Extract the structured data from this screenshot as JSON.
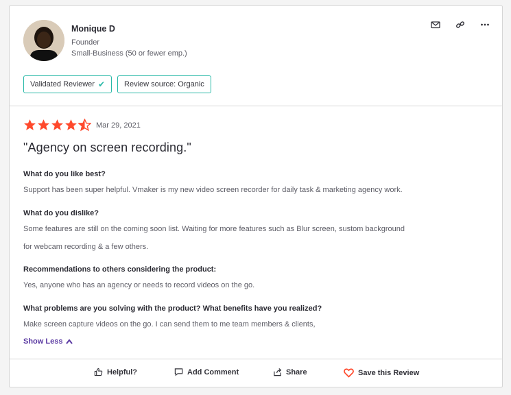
{
  "reviewer": {
    "name": "Monique D",
    "title": "Founder",
    "segment": "Small-Business (50 or fewer emp.)",
    "badges": [
      {
        "label": "Validated Reviewer",
        "icon": "check-icon"
      },
      {
        "label": "Review source: Organic"
      }
    ]
  },
  "header_actions": [
    "mail-icon",
    "link-icon",
    "more-icon"
  ],
  "review": {
    "rating": 4.5,
    "max_rating": 5,
    "date": "Mar 29, 2021",
    "title": "\"Agency on screen recording.\"",
    "qa": [
      {
        "question": "What do you like best?",
        "answer": "Support has been super helpful. Vmaker is my new video screen recorder for daily task & marketing agency work."
      },
      {
        "question": "What do you dislike?",
        "answer_lines": [
          "Some features are still on the coming soon list. Waiting for more features such as Blur screen, sustom background",
          "for webcam recording & a few others."
        ]
      },
      {
        "question": "Recommendations to others considering the product:",
        "answer": "Yes, anyone who has an agency or needs to record videos on the go."
      },
      {
        "question": "What problems are you solving with the product? What benefits have you realized?",
        "answer": "Make screen capture videos on the go. I can send them to me team members & clients,"
      }
    ],
    "show_less": "Show Less"
  },
  "footer": {
    "helpful": "Helpful?",
    "add_comment": "Add Comment",
    "share": "Share",
    "save": "Save this Review"
  },
  "colors": {
    "star": "#ff492c",
    "badge_border": "#27b8a7",
    "link_purple": "#5a39a2",
    "heart": "#ff492c"
  }
}
